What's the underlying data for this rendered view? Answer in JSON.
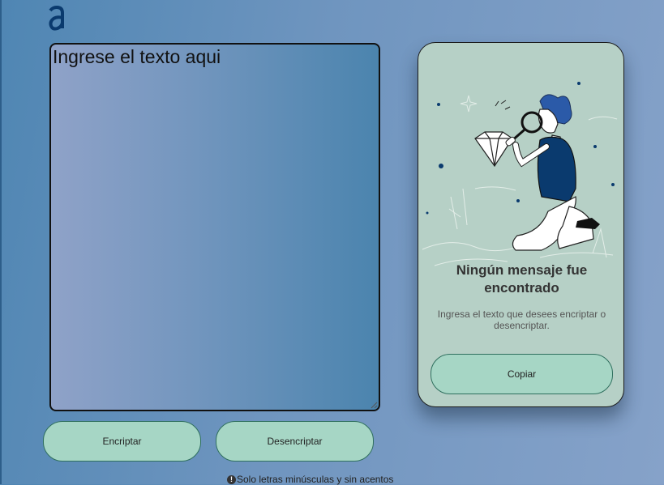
{
  "logo": {
    "glyph": "a",
    "color": "#0a3a6e"
  },
  "input": {
    "placeholder": "Ingrese el texto aqui",
    "value": ""
  },
  "buttons": {
    "encrypt": "Encriptar",
    "decrypt": "Desencriptar",
    "copy": "Copiar"
  },
  "hint": {
    "icon": "info-icon",
    "glyph": "!",
    "text": "Solo letras minúsculas y sin acentos"
  },
  "result": {
    "title": "Ningún mensaje fue encontrado",
    "subtitle": "Ingresa el texto que desees encriptar o desencriptar.",
    "illustration": "person-inspecting-diamond-illustration"
  },
  "colors": {
    "button_bg": "#a6d6c5",
    "card_bg": "#b6d0c6",
    "accent_dark_blue": "#0a3a6e"
  }
}
